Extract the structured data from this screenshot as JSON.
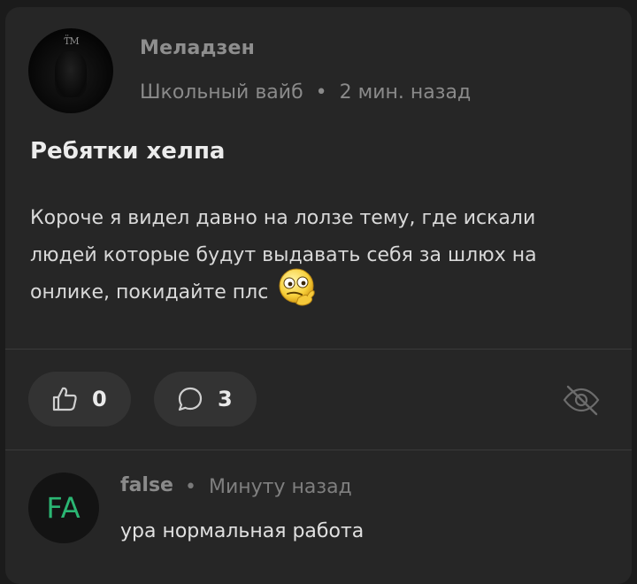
{
  "post": {
    "author": "Меладзен",
    "community": "Школьный вайб",
    "separator": "•",
    "time": "2 мин. назад",
    "title": "Ребятки хелпа",
    "body_lines": [
      "Короче я видел давно на лолзе тему, где искали",
      "людей которые будут выдавать себя за шлюх на",
      "онлике, покидайте плс"
    ],
    "avatar_mark": "Ƭ̈M",
    "emoji": "thinking-face-emoji"
  },
  "actions": {
    "likes": "0",
    "comments": "3",
    "like_icon": "thumbs-up-icon",
    "comment_icon": "comment-bubble-icon",
    "hide_icon": "eye-off-icon"
  },
  "comment": {
    "initials": "FA",
    "author": "false",
    "separator": "•",
    "time": "Минуту назад",
    "text": "ура нормальная работа",
    "accent_color": "#2bb673"
  }
}
